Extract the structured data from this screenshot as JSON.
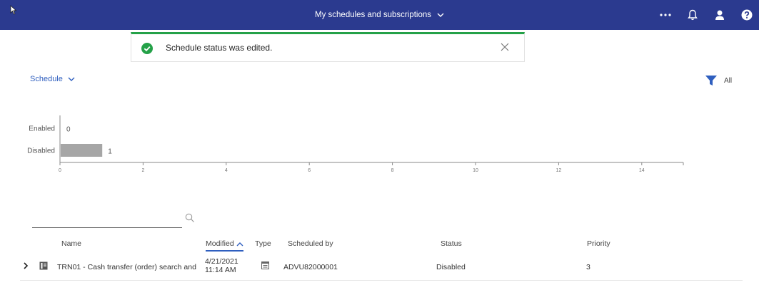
{
  "header": {
    "title": "My schedules and subscriptions"
  },
  "toast": {
    "message": "Schedule status was edited."
  },
  "view": {
    "dropdown_label": "Schedule",
    "filter_label": "All"
  },
  "chart_data": {
    "type": "bar",
    "orientation": "horizontal",
    "categories": [
      "Enabled",
      "Disabled"
    ],
    "values": [
      0,
      1
    ],
    "data_labels": [
      "0",
      "1"
    ],
    "xlim": [
      0,
      15
    ],
    "x_ticks": [
      0,
      2,
      4,
      6,
      8,
      10,
      12,
      14
    ],
    "x_tick_labels": [
      "0",
      "2",
      "4",
      "6",
      "8",
      "10",
      "12",
      "14"
    ],
    "bar_color": "#a6a6a6"
  },
  "table": {
    "search_placeholder": "",
    "columns": [
      "Name",
      "Modified",
      "Type",
      "Scheduled by",
      "Status",
      "Priority"
    ],
    "rows": [
      {
        "name": "TRN01 - Cash transfer (order) search and",
        "modified_date": "4/21/2021",
        "modified_time": "11:14 AM",
        "type_icon": "schedule-type-icon",
        "scheduled_by": "ADVU82000001",
        "status": "Disabled",
        "priority": "3"
      }
    ]
  },
  "colors": {
    "header_bg": "#2b3a8f",
    "accent": "#2f5fbf",
    "success": "#24a148"
  }
}
